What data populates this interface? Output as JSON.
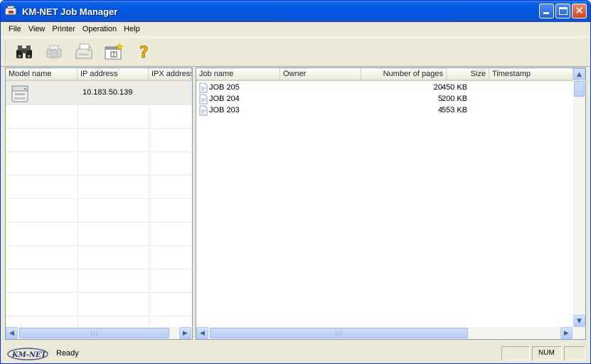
{
  "window": {
    "title": "KM-NET Job Manager"
  },
  "menu": [
    "File",
    "View",
    "Printer",
    "Operation",
    "Help"
  ],
  "toolbar": {
    "icons": [
      "binoculars-icon",
      "gear-printer-icon",
      "printer-select-icon",
      "job-panel-icon",
      "help-icon"
    ]
  },
  "printers": {
    "columns": [
      "Model name",
      "IP address",
      "IPX address"
    ],
    "rows": [
      {
        "model": "",
        "ip": "10.183.50.139",
        "ipx": ""
      }
    ]
  },
  "jobs": {
    "columns": [
      "Job name",
      "Owner",
      "Number of pages",
      "Size",
      "Timestamp"
    ],
    "rows": [
      {
        "name": "JOB 205",
        "owner": "",
        "pages": "20",
        "size": "450 KB",
        "timestamp": ""
      },
      {
        "name": "JOB 204",
        "owner": "",
        "pages": "5",
        "size": "200 KB",
        "timestamp": ""
      },
      {
        "name": "JOB 203",
        "owner": "",
        "pages": "4",
        "size": "553 KB",
        "timestamp": ""
      }
    ]
  },
  "status": {
    "logo_text": "KM-NET",
    "text": "Ready",
    "num": "NUM"
  },
  "colors": {
    "titlebar": "#0054e3",
    "chrome": "#ece9d8",
    "selected_row": "#ecebe6"
  }
}
